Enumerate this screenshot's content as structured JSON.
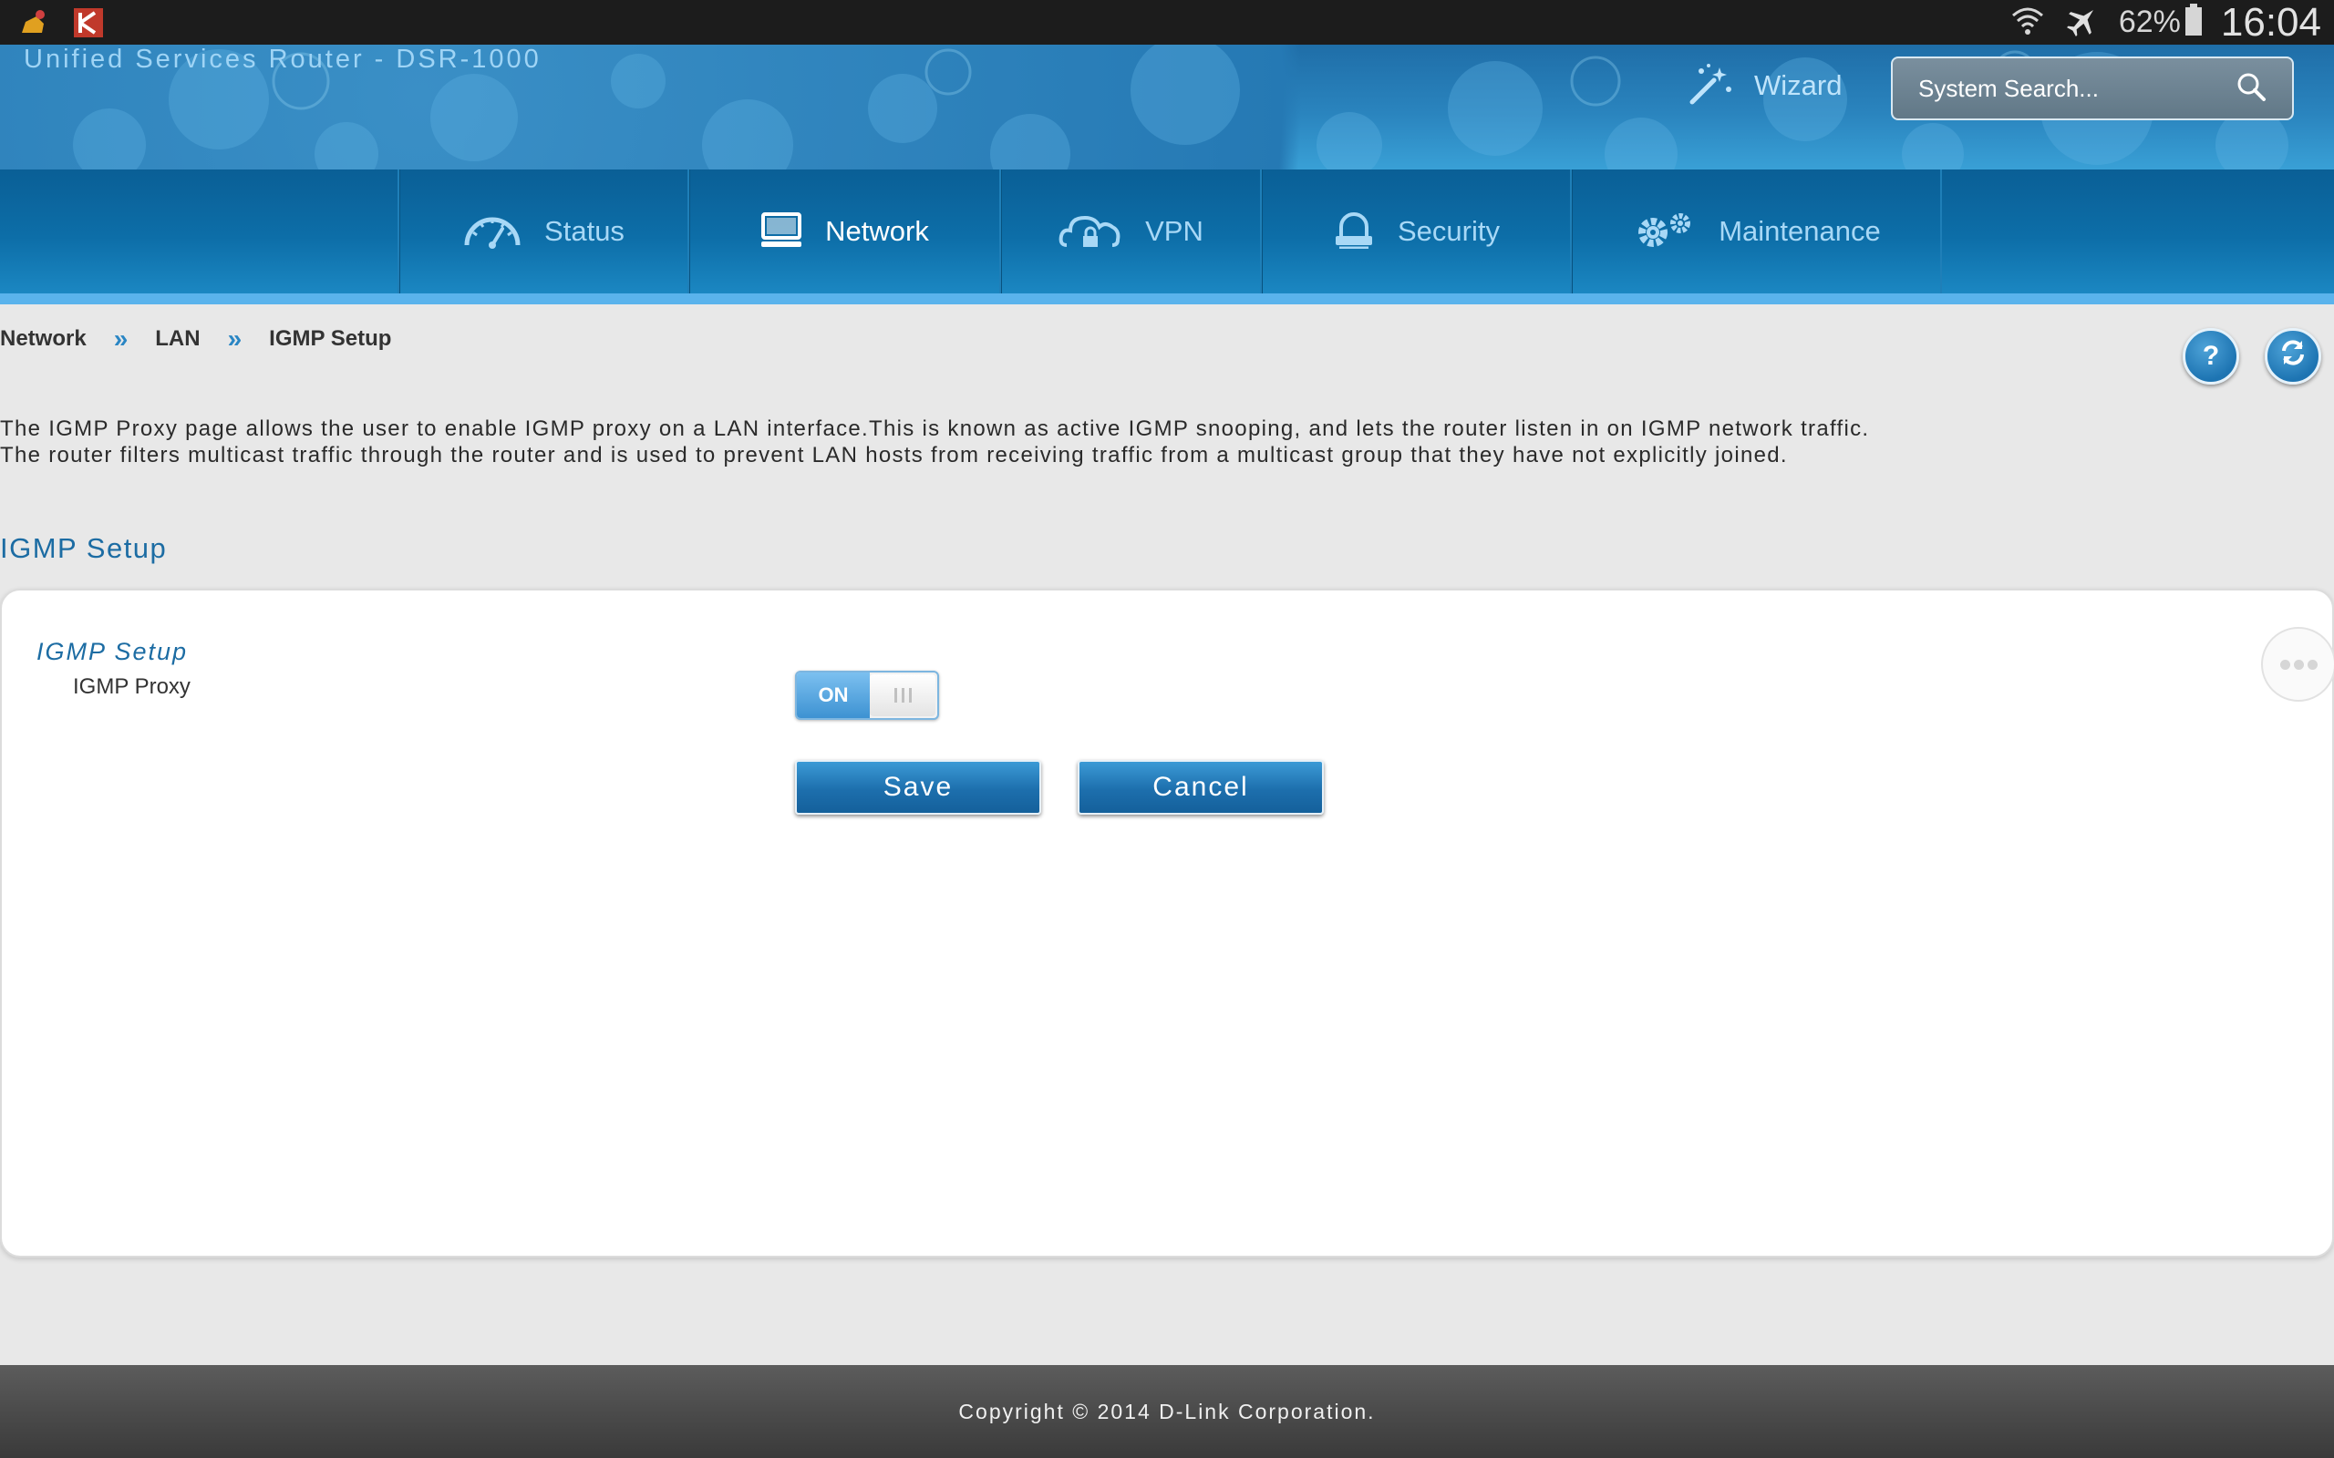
{
  "status_bar": {
    "battery": "62%",
    "time": "16:04",
    "icons": [
      "notification-app-icon",
      "kaspersky-icon",
      "wifi-icon",
      "airplane-mode-icon",
      "battery-icon"
    ]
  },
  "header": {
    "title": "Unified Services Router - DSR-1000",
    "wizard_label": "Wizard",
    "search_placeholder": "System Search..."
  },
  "nav": {
    "items": [
      {
        "label": "Status",
        "icon": "speedometer-icon"
      },
      {
        "label": "Network",
        "icon": "monitor-icon",
        "active": true
      },
      {
        "label": "VPN",
        "icon": "cloud-lock-icon"
      },
      {
        "label": "Security",
        "icon": "lock-icon"
      },
      {
        "label": "Maintenance",
        "icon": "gears-icon"
      }
    ]
  },
  "breadcrumb": {
    "items": [
      "Network",
      "LAN",
      "IGMP Setup"
    ],
    "separator": "»"
  },
  "description": "The IGMP Proxy page allows the user to enable IGMP proxy on a LAN interface.This is known as active IGMP snooping, and lets the router listen in on IGMP network traffic. The router filters multicast traffic through the router and is used to prevent LAN hosts from receiving traffic from a multicast group that they have not explicitly joined.",
  "section_title": "IGMP Setup",
  "panel": {
    "heading": "IGMP Setup",
    "field_label": "IGMP Proxy",
    "toggle_label": "ON",
    "toggle_state": true,
    "save_label": "Save",
    "cancel_label": "Cancel"
  },
  "help_button": "?",
  "footer": {
    "copyright": "Copyright © 2014 D-Link Corporation."
  },
  "colors": {
    "accent": "#1c6ca3",
    "nav_bg": "#0d6ea8",
    "button": "#1d6fad"
  }
}
